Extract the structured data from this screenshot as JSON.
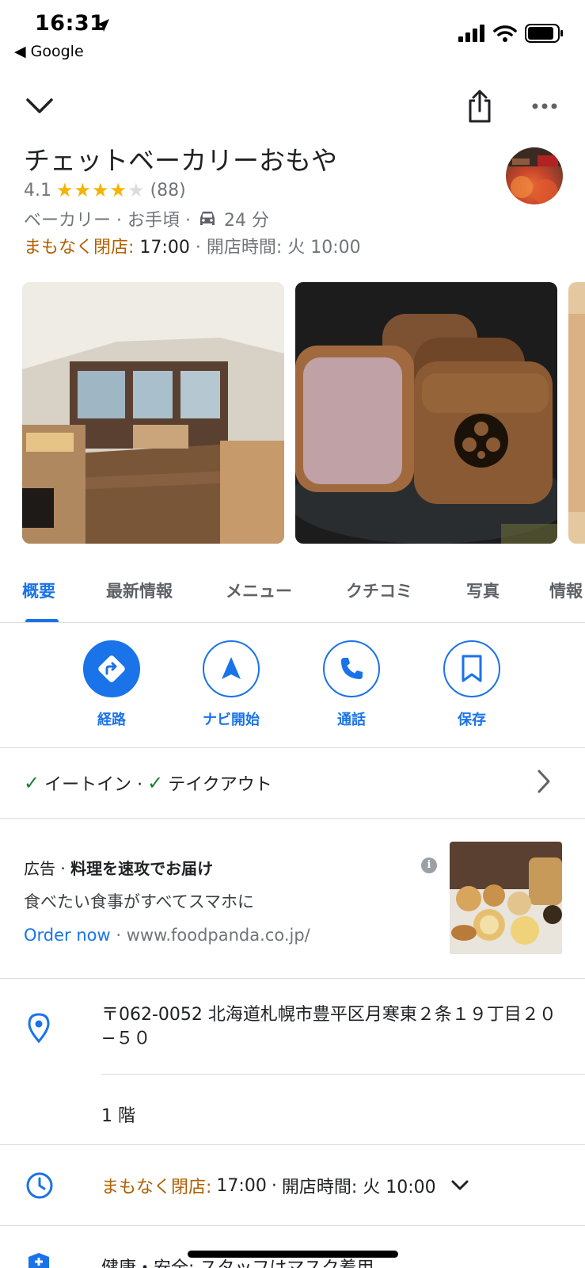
{
  "status_bar": {
    "time": "16:31",
    "back_label": "◀ Google"
  },
  "place": {
    "name": "チェットベーカリーおもや",
    "rating": "4.1",
    "review_count": "(88)",
    "stars_filled": 4,
    "category_price": "ベーカリー · お手頃 ·",
    "drive_time": "24 分",
    "closing_soon_label": "まもなく閉店:",
    "closing_time": "17:00",
    "separator": "·",
    "open_info": "開店時間: 火 10:00"
  },
  "tabs": [
    {
      "label": "概要",
      "active": true
    },
    {
      "label": "最新情報",
      "active": false
    },
    {
      "label": "メニュー",
      "active": false
    },
    {
      "label": "クチコミ",
      "active": false
    },
    {
      "label": "写真",
      "active": false
    },
    {
      "label": "情報",
      "active": false
    }
  ],
  "actions": [
    {
      "label": "経路",
      "icon": "directions-icon"
    },
    {
      "label": "ナビ開始",
      "icon": "navigation-icon"
    },
    {
      "label": "通話",
      "icon": "phone-icon"
    },
    {
      "label": "保存",
      "icon": "bookmark-icon"
    }
  ],
  "services": {
    "eat_in": "イートイン ·",
    "takeout": "テイクアウト"
  },
  "ad": {
    "badge": "広告 ·",
    "title": "料理を速攻でお届け",
    "description": "食べたい食事がすべてスマホに",
    "cta": "Order now",
    "url": " · www.foodpanda.co.jp/",
    "info_glyph": "i"
  },
  "address": {
    "line": "〒062-0052 北海道札幌市豊平区月寒東２条１９丁目２０−５０",
    "floor": "1 階"
  },
  "hours": {
    "closing_soon_label": "まもなく閉店:",
    "closing_time": "17:00",
    "separator": "·",
    "open_info": "開店時間: 火 10:00"
  },
  "health": {
    "text": "健康・安全: スタッフはマスク着用"
  },
  "colors": {
    "accent": "#1a73e8",
    "warning": "#b06000",
    "star": "#f4b400",
    "check": "#188038"
  }
}
